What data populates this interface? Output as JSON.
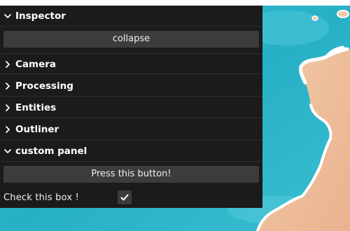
{
  "inspector": {
    "title": "Inspector",
    "state": "expanded",
    "collapse_button_label": "collapse"
  },
  "sections": [
    {
      "label": "Camera",
      "state": "collapsed"
    },
    {
      "label": "Processing",
      "state": "collapsed"
    },
    {
      "label": "Entities",
      "state": "collapsed"
    },
    {
      "label": "Outliner",
      "state": "collapsed"
    }
  ],
  "custom_panel": {
    "title": "custom panel",
    "state": "expanded",
    "button_label": "Press this button!",
    "checkbox_label": "Check this box !",
    "checkbox_checked": true
  },
  "icons": {
    "expanded": "chevron-down-icon",
    "collapsed": "chevron-right-icon",
    "check": "checkmark-icon"
  },
  "colors": {
    "panel_bg": "#1b1b1b",
    "button_bg": "#3c3c3c",
    "text": "#ffffff",
    "ocean": "#2bb3c8",
    "land": "#f0c4a4"
  }
}
